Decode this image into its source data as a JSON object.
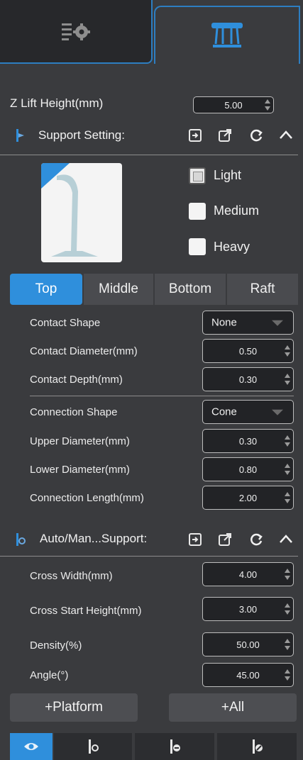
{
  "tabs": [
    {
      "icon": "settings-list-icon"
    },
    {
      "icon": "support-pillars-icon"
    }
  ],
  "z_lift": {
    "label": "Z Lift Height(mm)",
    "value": "5.00"
  },
  "support_setting": {
    "title": "Support Setting:",
    "presets": [
      {
        "label": "Light",
        "checked": true
      },
      {
        "label": "Medium",
        "checked": false
      },
      {
        "label": "Heavy",
        "checked": false
      }
    ]
  },
  "segments": [
    {
      "label": "Top",
      "active": true
    },
    {
      "label": "Middle",
      "active": false
    },
    {
      "label": "Bottom",
      "active": false
    },
    {
      "label": "Raft",
      "active": false
    }
  ],
  "top_fields": {
    "contact_shape": {
      "label": "Contact Shape",
      "value": "None"
    },
    "contact_diameter": {
      "label": "Contact Diameter(mm)",
      "value": "0.50"
    },
    "contact_depth": {
      "label": "Contact Depth(mm)",
      "value": "0.30"
    },
    "connection_shape": {
      "label": "Connection Shape",
      "value": "Cone"
    },
    "upper_diameter": {
      "label": "Upper Diameter(mm)",
      "value": "0.30"
    },
    "lower_diameter": {
      "label": "Lower Diameter(mm)",
      "value": "0.80"
    },
    "connection_length": {
      "label": "Connection Length(mm)",
      "value": "2.00"
    }
  },
  "auto_support": {
    "title": "Auto/Man...Support:",
    "cross_width": {
      "label": "Cross Width(mm)",
      "value": "4.00"
    },
    "cross_start_height": {
      "label": "Cross Start Height(mm)",
      "value": "3.00"
    },
    "density": {
      "label": "Density(%)",
      "value": "50.00"
    },
    "angle": {
      "label": "Angle(°)",
      "value": "45.00"
    }
  },
  "buttons": {
    "platform": "+Platform",
    "all": "+All"
  },
  "colors": {
    "accent": "#2f8fdc",
    "panel": "#3a3b3e"
  }
}
